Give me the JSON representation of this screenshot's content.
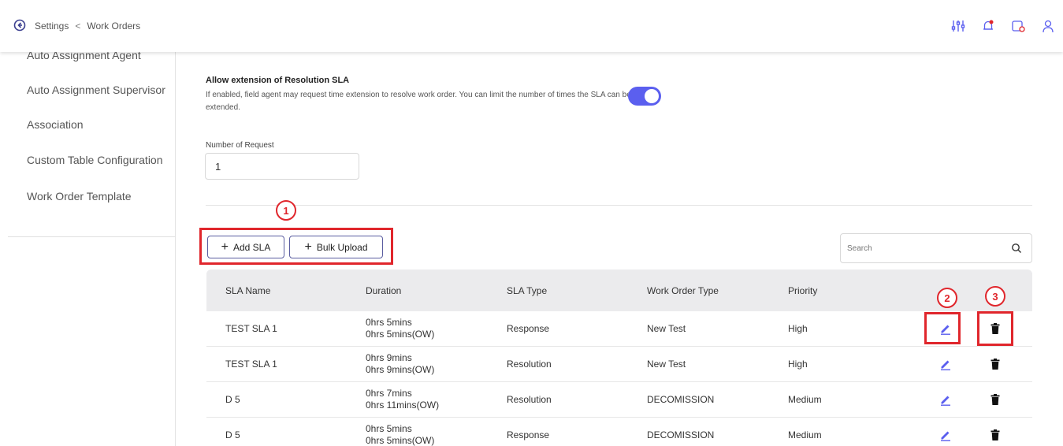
{
  "header": {
    "breadcrumb": [
      "Settings",
      "Work Orders"
    ],
    "separator": "<",
    "icons": [
      "back-icon",
      "filter-sliders-icon",
      "notification-bell-icon",
      "calendar-check-icon",
      "user-profile-icon"
    ]
  },
  "sidebar": {
    "items": [
      {
        "label": "Auto Assignment Agent"
      },
      {
        "label": "Auto Assignment Supervisor"
      },
      {
        "label": "Association"
      },
      {
        "label": "Custom Table Configuration"
      },
      {
        "label": "Work Order Template"
      }
    ]
  },
  "extension": {
    "title": "Allow extension of Resolution SLA",
    "description": "If enabled, field agent may request time extension to resolve work order. You can limit the number of times the SLA can be extended.",
    "toggle_on": true
  },
  "request": {
    "label": "Number of Request",
    "value": "1"
  },
  "actions": {
    "add_sla": "Add SLA",
    "bulk_upload": "Bulk Upload",
    "plus": "+"
  },
  "search": {
    "placeholder": "Search"
  },
  "annotations": {
    "marker_1": "1",
    "marker_2": "2",
    "marker_3": "3",
    "color": "#e0262c"
  },
  "table": {
    "columns": [
      "SLA Name",
      "Duration",
      "SLA Type",
      "Work Order Type",
      "Priority"
    ],
    "rows": [
      {
        "name": "TEST SLA 1",
        "duration": "0hrs 5mins",
        "duration_ow": "0hrs 5mins(OW)",
        "type": "Response",
        "wo_type": "New Test",
        "priority": "High"
      },
      {
        "name": "TEST SLA 1",
        "duration": "0hrs 9mins",
        "duration_ow": "0hrs 9mins(OW)",
        "type": "Resolution",
        "wo_type": "New Test",
        "priority": "High"
      },
      {
        "name": "D 5",
        "duration": "0hrs 7mins",
        "duration_ow": "0hrs 11mins(OW)",
        "type": "Resolution",
        "wo_type": "DECOMISSION",
        "priority": "Medium"
      },
      {
        "name": "D 5",
        "duration": "0hrs 5mins",
        "duration_ow": "0hrs 5mins(OW)",
        "type": "Response",
        "wo_type": "DECOMISSION",
        "priority": "Medium"
      }
    ]
  },
  "colors": {
    "accent": "#5b5fef",
    "edit_icon": "#5b5fef",
    "header_bg": "#ebebed"
  }
}
